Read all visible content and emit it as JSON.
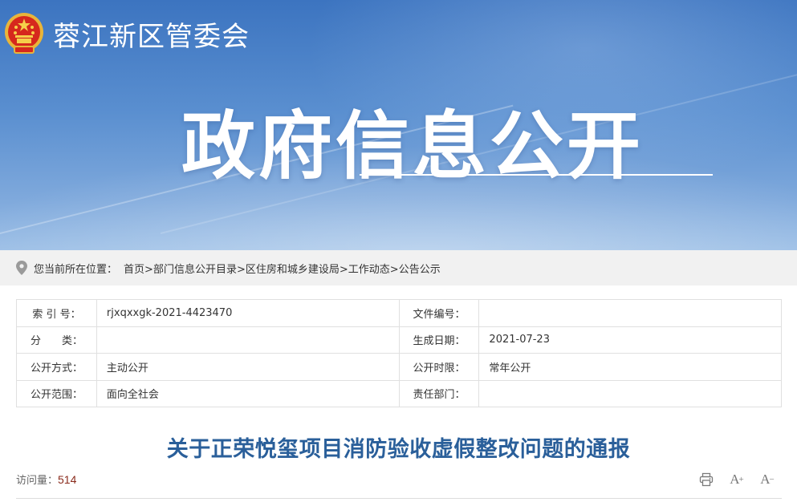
{
  "header": {
    "site_name": "蓉江新区管委会",
    "hero_title": "政府信息公开",
    "emblem_icon": "national-emblem-icon"
  },
  "breadcrumb": {
    "prefix": "您当前所在位置：",
    "items": [
      "首页",
      "部门信息公开目录",
      "区住房和城乡建设局",
      "工作动态",
      "公告公示"
    ],
    "separator": ">"
  },
  "info": {
    "rows": [
      {
        "l1": "索 引 号：",
        "v1": "rjxqxxgk-2021-4423470",
        "l2": "文件编号：",
        "v2": ""
      },
      {
        "l1": "分　　类：",
        "v1": "",
        "l2": "生成日期：",
        "v2": "2021-07-23"
      },
      {
        "l1": "公开方式：",
        "v1": "主动公开",
        "l2": "公开时限：",
        "v2": "常年公开"
      },
      {
        "l1": "公开范围：",
        "v1": "面向全社会",
        "l2": "责任部门：",
        "v2": ""
      }
    ]
  },
  "article": {
    "title": "关于正荣悦玺项目消防验收虚假整改问题的通报",
    "views_label": "访问量：",
    "views_count": "514"
  },
  "tools": {
    "enlarge_label": "A",
    "shrink_label": "A",
    "enlarge_sup": "+",
    "shrink_sup": "−"
  },
  "colors": {
    "banner": "#4f86cc",
    "title_blue": "#2a5f9a",
    "count_red": "#8a2b1c"
  }
}
